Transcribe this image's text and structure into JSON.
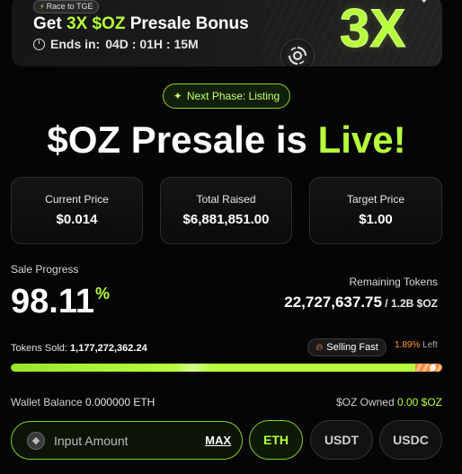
{
  "banner": {
    "badge": "Race to TGE",
    "title_prefix": "Get ",
    "title_highlight": "3X $OZ",
    "title_suffix": " Presale Bonus",
    "ends_label": "Ends in:",
    "countdown": "04D : 01H : 15M",
    "big_text": "3X"
  },
  "next_phase": "Next Phase: Listing",
  "headline": {
    "prefix": "$OZ Presale is ",
    "highlight": "Live!"
  },
  "stats": [
    {
      "label": "Current Price",
      "value": "$0.014"
    },
    {
      "label": "Total Raised",
      "value": "$6,881,851.00"
    },
    {
      "label": "Target Price",
      "value": "$1.00"
    }
  ],
  "progress": {
    "label": "Sale Progress",
    "percent_value": "98.11",
    "percent_sign": "%",
    "percent_fraction": 0.9811,
    "remaining_label": "Remaining Tokens",
    "remaining_value": "22,727,637.75",
    "remaining_total": " / 1.2B $OZ",
    "tokens_sold_label": "Tokens Sold: ",
    "tokens_sold_value": "1,177,272,362.24",
    "selling_fast": "Selling Fast",
    "left_pct": "1.89%",
    "left_word": " Left"
  },
  "wallet": {
    "balance_label": "Wallet Balance ",
    "balance_value": "0.000000 ETH",
    "owned_label": "$OZ Owned ",
    "owned_value": "0.00 $OZ"
  },
  "purchase": {
    "placeholder": "Input Amount",
    "max_label": "MAX",
    "currencies": [
      "ETH",
      "USDT",
      "USDC"
    ],
    "active_currency": "ETH"
  },
  "colors": {
    "accent": "#b6ff3c",
    "warning": "#ff8a3c",
    "background": "#050505"
  }
}
